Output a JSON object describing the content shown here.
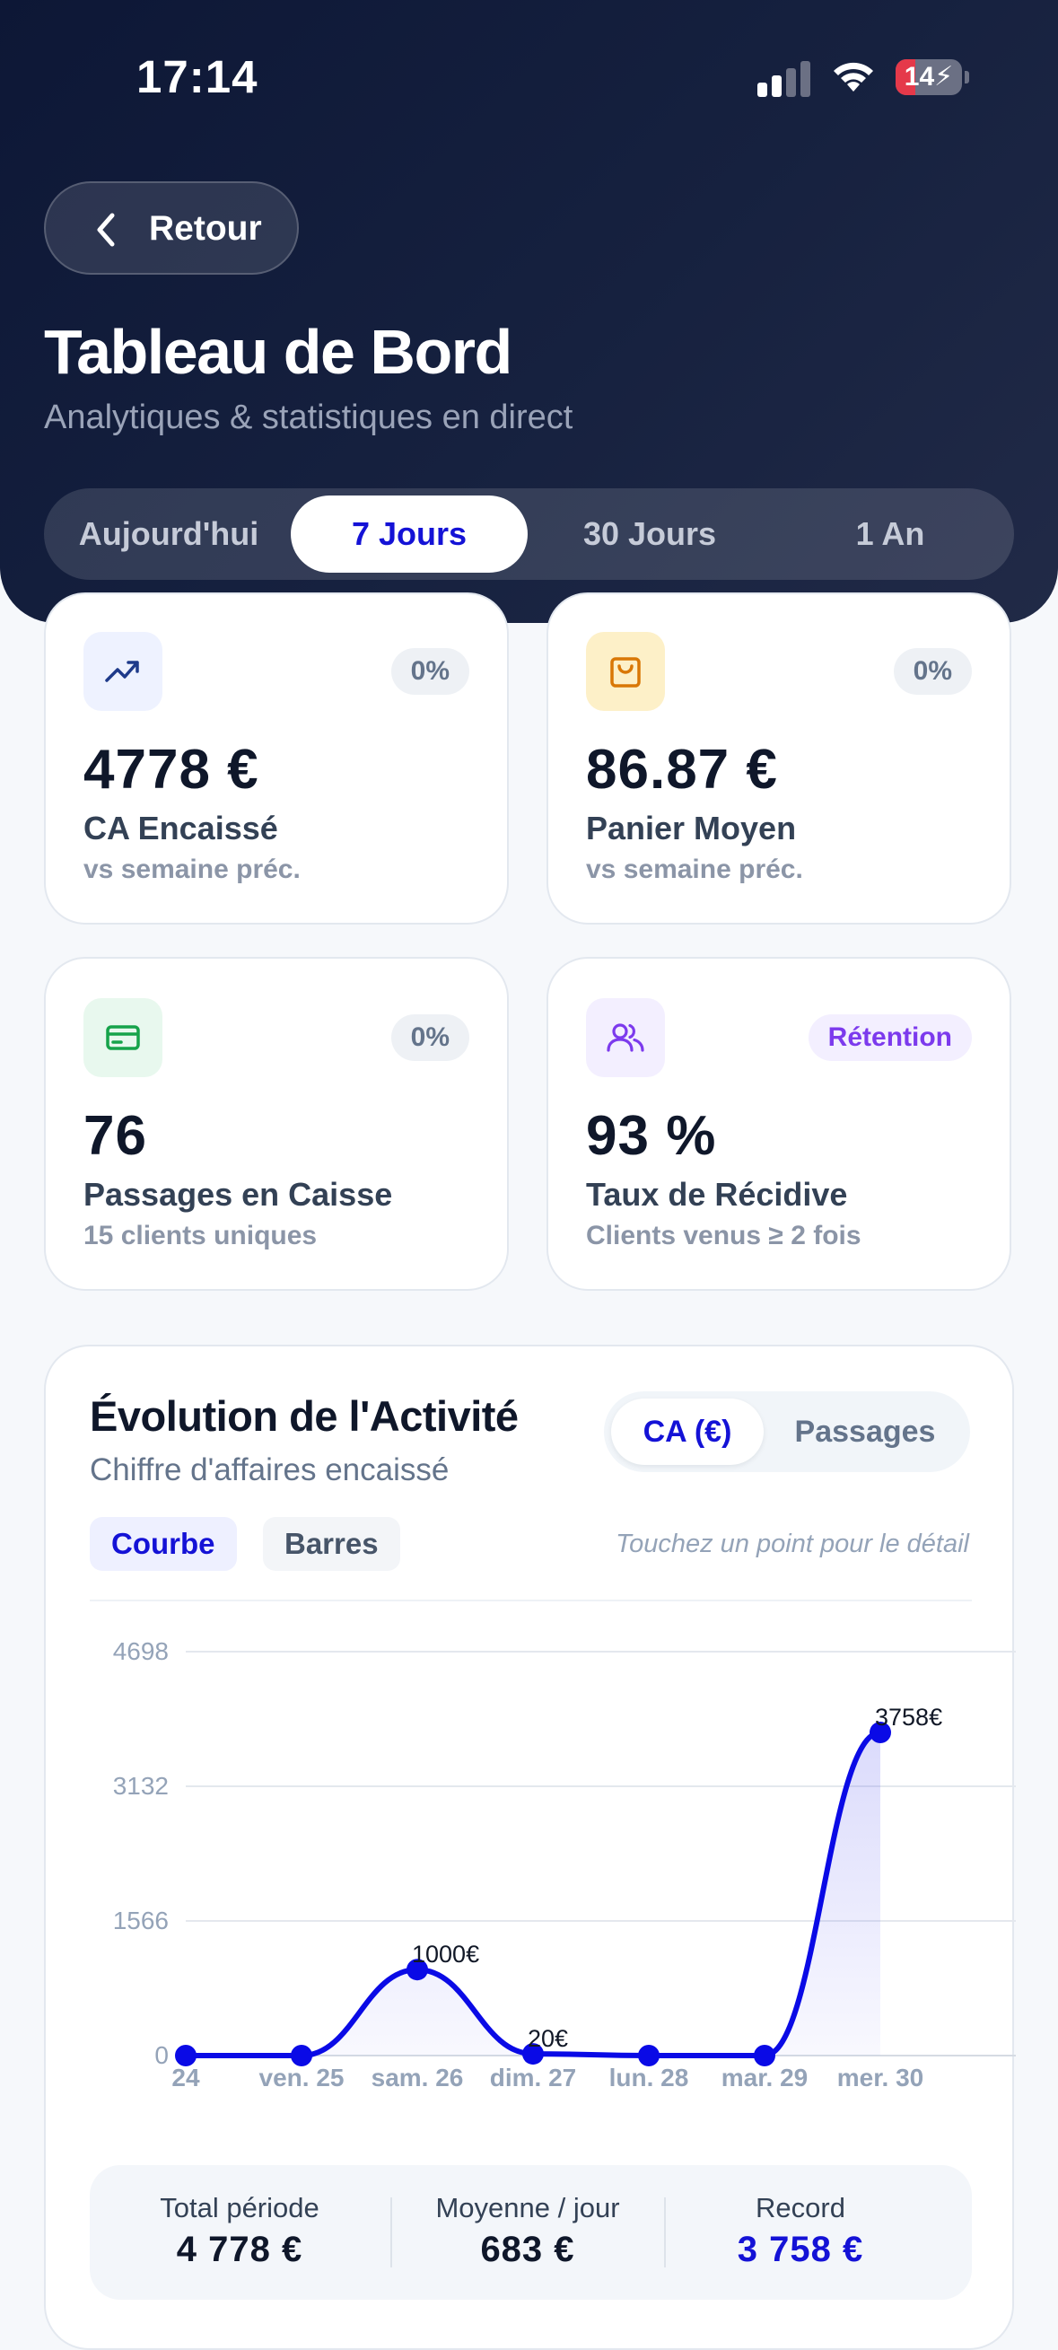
{
  "status_bar": {
    "time": "17:14",
    "battery": "14"
  },
  "header": {
    "back_label": "Retour",
    "title": "Tableau de Bord",
    "subtitle": "Analytiques & statistiques en direct",
    "periods": [
      "Aujourd'hui",
      "7 Jours",
      "30 Jours",
      "1 An"
    ],
    "active_period": "7 Jours"
  },
  "kpis": [
    {
      "value": "4778 €",
      "label": "CA Encaissé",
      "sub": "vs semaine préc.",
      "badge": "0%",
      "icon": "trending-up-icon"
    },
    {
      "value": "86.87 €",
      "label": "Panier Moyen",
      "sub": "vs semaine préc.",
      "badge": "0%",
      "icon": "shopping-bag-icon"
    },
    {
      "value": "76",
      "label": "Passages en Caisse",
      "sub": "15 clients uniques",
      "badge": "0%",
      "icon": "credit-card-icon"
    },
    {
      "value": "93 %",
      "label": "Taux de Récidive",
      "sub": "Clients venus ≥ 2 fois",
      "badge": "Rétention",
      "icon": "users-icon"
    }
  ],
  "activity": {
    "title": "Évolution de l'Activité",
    "subtitle": "Chiffre d'affaires encaissé",
    "metric_options": [
      "CA (€)",
      "Passages"
    ],
    "active_metric": "CA (€)",
    "view_options": [
      "Courbe",
      "Barres"
    ],
    "active_view": "Courbe",
    "hint": "Touchez un point pour le détail"
  },
  "chart_data": {
    "type": "line",
    "x": [
      "24",
      "ven. 25",
      "sam. 26",
      "dim. 27",
      "lun. 28",
      "mar. 29",
      "mer. 30"
    ],
    "series": [
      {
        "values": [
          0,
          0,
          1000,
          20,
          0,
          0,
          3758
        ]
      }
    ],
    "point_labels": [
      "",
      "",
      "1000€",
      "20€",
      "",
      "",
      "3758€"
    ],
    "yticks": [
      0,
      1566,
      3132,
      4698
    ],
    "ylim": [
      0,
      4698
    ],
    "grid": true,
    "area_fill": true,
    "line_color": "#0a0ae6"
  },
  "summary": [
    {
      "key": "Total période",
      "value": "4 778 €"
    },
    {
      "key": "Moyenne / jour",
      "value": "683 €"
    },
    {
      "key": "Record",
      "value": "3 758 €"
    }
  ],
  "colors": {
    "accent": "#1412d6",
    "header_bg": "#111a3a",
    "success": "#16a34a",
    "warning": "#d97706",
    "purple": "#7c3aed"
  }
}
